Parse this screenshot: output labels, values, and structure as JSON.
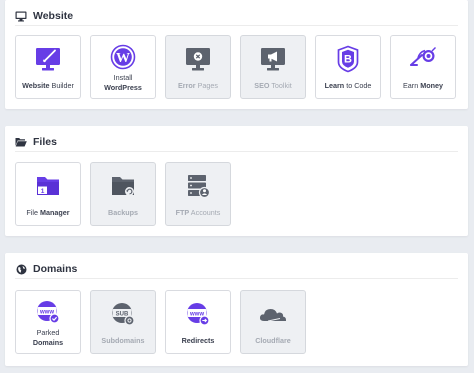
{
  "sections": {
    "website": {
      "title": "Website",
      "tiles": [
        {
          "pre": "",
          "bold": "Website",
          "post": " Builder"
        },
        {
          "pre": "Install",
          "bold": "WordPress",
          "post": ""
        },
        {
          "pre": "",
          "bold": "Error",
          "post": " Pages"
        },
        {
          "pre": "",
          "bold": "SEO",
          "post": " Toolkit"
        },
        {
          "pre": "",
          "bold": "Learn",
          "post": " to Code"
        },
        {
          "pre": "",
          "bold": "Earn ",
          "post": "Money"
        }
      ]
    },
    "files": {
      "title": "Files",
      "tiles": [
        {
          "pre": "",
          "bold": "File ",
          "post": "Manager"
        },
        {
          "pre": "",
          "bold": "Backups",
          "post": ""
        },
        {
          "pre": "",
          "bold": "FTP",
          "post": " Accounts"
        }
      ]
    },
    "domains": {
      "title": "Domains",
      "tiles": [
        {
          "pre": "Parked",
          "bold": "Domains",
          "post": ""
        },
        {
          "pre": "",
          "bold": "Subdomains",
          "post": ""
        },
        {
          "pre": "",
          "bold": "Redirects",
          "post": ""
        },
        {
          "pre": "",
          "bold": "Cloudflare",
          "post": ""
        }
      ]
    }
  },
  "colors": {
    "purple": "#673de6",
    "purple_light": "#8c6cf0",
    "gray_icon": "#5d636e",
    "disabled_bg": "#eef0f3"
  }
}
